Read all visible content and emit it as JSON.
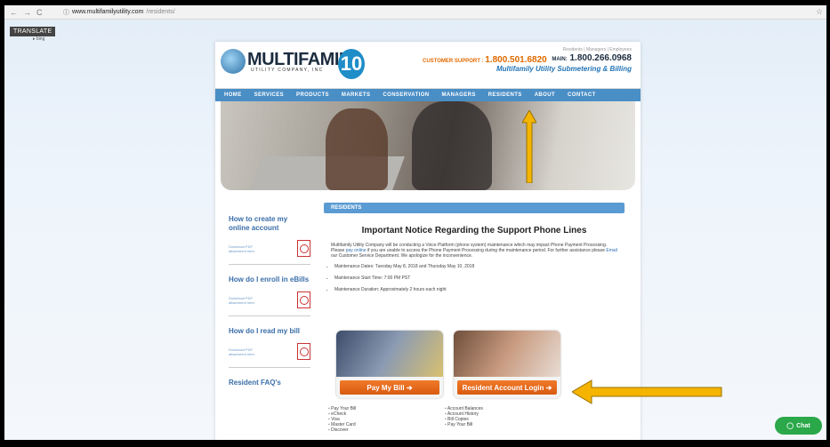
{
  "browser": {
    "back": "←",
    "forward": "→",
    "reload": "C",
    "info_icon": "ⓘ",
    "url_host": "www.multifamilyutility.com",
    "url_path": "/residents/",
    "star": "☆"
  },
  "translate": {
    "label": "TRANSLATE",
    "powered": "bing"
  },
  "header": {
    "logo_text": "MULTIFAMILY",
    "logo_sub": "UTILITY COMPANY, INC",
    "anniversary": "10",
    "top_links": "Residents | Managers | Employees",
    "support_label": "CUSTOMER SUPPORT :",
    "support_phone": "1.800.501.6820",
    "main_label": "MAIN:",
    "main_phone": "1.800.266.0968",
    "tagline": "Multifamily Utility Submetering & Billing"
  },
  "menu": [
    "HOME",
    "SERVICES",
    "PRODUCTS",
    "MARKETS",
    "CONSERVATION",
    "MANAGERS",
    "RESIDENTS",
    "ABOUT",
    "CONTACT"
  ],
  "sidebar": [
    {
      "question": "How to create my online account",
      "download": "Download PDF attachment here."
    },
    {
      "question": "How do I enroll in eBills",
      "download": "Download PDF attachment here."
    },
    {
      "question": "How do I read my bill",
      "download": "Download PDF attachment here."
    },
    {
      "question": "Resident FAQ's",
      "download": ""
    }
  ],
  "section_bar": "RESIDENTS",
  "notice": {
    "title": "Important Notice Regarding the Support Phone Lines",
    "body_1": "Multifamily Utility Company will be conducting a Voice Platform (phone system) maintenance which may impact Phone Payment Processing. Please ",
    "body_link": "pay online",
    "body_2": " if you are unable to access the Phone Payment Processing during the maintenance period. For further assistance please ",
    "body_email": "Email",
    "body_3": " our Customer Service Department. We apologize for the inconvenience.",
    "items": [
      "Maintenance Dates: Tuesday May 8, 2018 and Thursday May 10, 2018",
      "Maintenance Start Time: 7:00 PM PST",
      "Maintenance Duration: Approximately 2 hours each night"
    ]
  },
  "cards": {
    "pay_bill": "Pay My Bill",
    "login": "Resident Account Login"
  },
  "pay_list": [
    "Pay Your Bill",
    "eCheck",
    "Visa",
    "Master Card",
    "Discover"
  ],
  "account_list": [
    "Account Balances",
    "Account History",
    "Bill Copies",
    "Pay Your Bill"
  ],
  "chat": {
    "label": "Chat"
  },
  "colors": {
    "menu_blue": "#4a8ec6",
    "orange": "#e06a00",
    "arrow_gold": "#f4b400",
    "chat_green": "#2aa84a"
  }
}
